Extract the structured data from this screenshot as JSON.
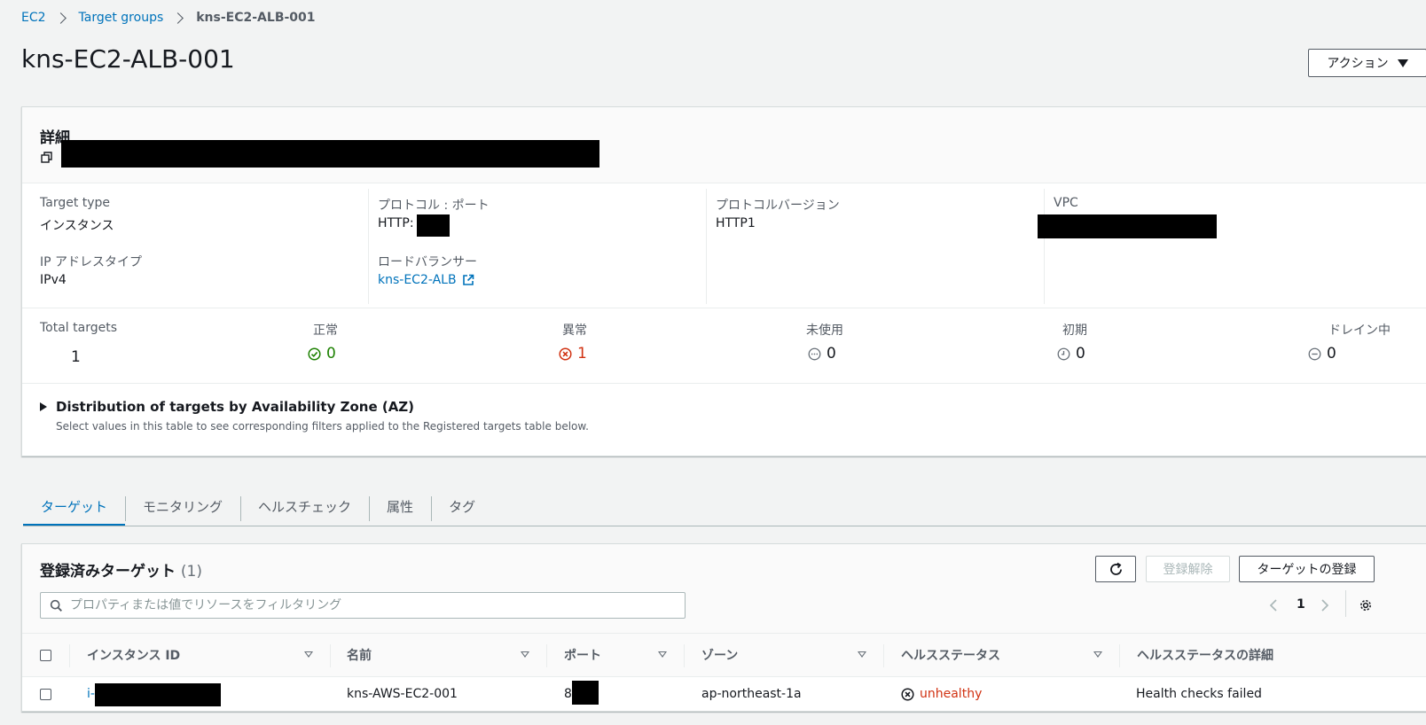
{
  "breadcrumb": {
    "items": [
      "EC2",
      "Target groups"
    ],
    "current": "kns-EC2-ALB-001"
  },
  "page": {
    "title": "kns-EC2-ALB-001",
    "action_label": "アクション"
  },
  "details": {
    "title": "詳細",
    "target_type_label": "Target type",
    "target_type_value": "インスタンス",
    "ip_type_label": "IP アドレスタイプ",
    "ip_type_value": "IPv4",
    "protocol_port_label": "プロトコル : ポート",
    "protocol_port_value": "HTTP: 8",
    "load_balancer_label": "ロードバランサー",
    "load_balancer_value": "kns-EC2-ALB",
    "protocol_version_label": "プロトコルバージョン",
    "protocol_version_value": "HTTP1",
    "vpc_label": "VPC"
  },
  "stats": {
    "total_label": "Total targets",
    "total_value": "1",
    "healthy_label": "正常",
    "healthy_value": "0",
    "unhealthy_label": "異常",
    "unhealthy_value": "1",
    "unused_label": "未使用",
    "unused_value": "0",
    "initial_label": "初期",
    "initial_value": "0",
    "draining_label": "ドレイン中",
    "draining_value": "0"
  },
  "distribution": {
    "title": "Distribution of targets by Availability Zone (AZ)",
    "subtitle": "Select values in this table to see corresponding filters applied to the Registered targets table below."
  },
  "tabs": [
    "ターゲット",
    "モニタリング",
    "ヘルスチェック",
    "属性",
    "タグ"
  ],
  "targets": {
    "title": "登録済みターゲット",
    "count": "(1)",
    "deregister_label": "登録解除",
    "register_label": "ターゲットの登録",
    "search_placeholder": "プロパティまたは値でリソースをフィルタリング",
    "page_number": "1",
    "columns": [
      "インスタンス ID",
      "名前",
      "ポート",
      "ゾーン",
      "ヘルスステータス",
      "ヘルスステータスの詳細"
    ],
    "rows": [
      {
        "instance_id": "i-",
        "name": "kns-AWS-EC2-001",
        "port": "8",
        "zone": "ap-northeast-1a",
        "health": "unhealthy",
        "health_detail": "Health checks failed"
      }
    ]
  },
  "colors": {
    "link": "#0073bb",
    "healthy": "#1d8102",
    "unhealthy": "#d13212",
    "neutral": "#687078"
  }
}
